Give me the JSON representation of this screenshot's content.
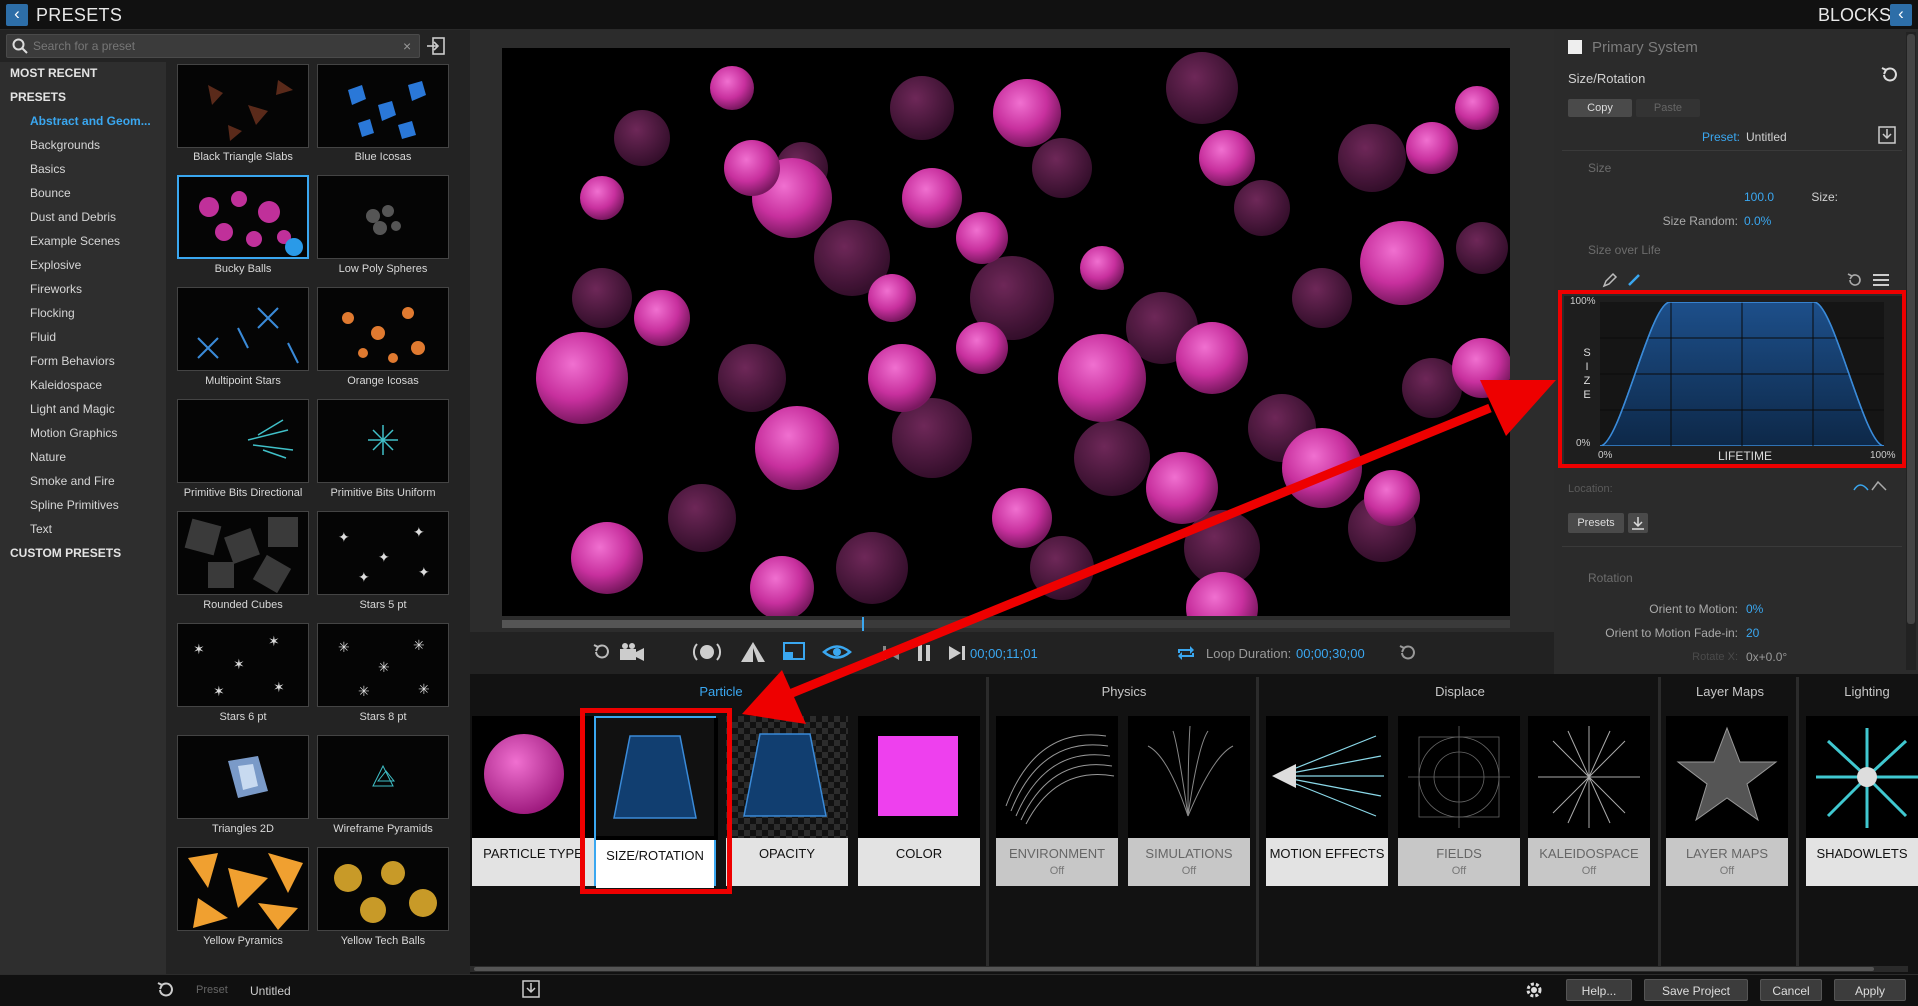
{
  "header": {
    "left_title": "PRESETS",
    "right_title": "BLOCKS",
    "back_icon": "chevron-left-icon"
  },
  "search": {
    "placeholder": "Search for a preset",
    "clear": "×"
  },
  "categories": {
    "most_recent": "MOST RECENT",
    "presets": "PRESETS",
    "items": [
      "Abstract and Geom...",
      "Backgrounds",
      "Basics",
      "Bounce",
      "Dust and Debris",
      "Example Scenes",
      "Explosive",
      "Fireworks",
      "Flocking",
      "Fluid",
      "Form Behaviors",
      "Kaleidospace",
      "Light and Magic",
      "Motion Graphics",
      "Nature",
      "Smoke and Fire",
      "Spline Primitives",
      "Text"
    ],
    "custom": "CUSTOM PRESETS"
  },
  "presets": [
    "Black Triangle Slabs",
    "Blue Icosas",
    "Bucky Balls",
    "Low Poly Spheres",
    "Multipoint Stars",
    "Orange Icosas",
    "Primitive Bits Directional",
    "Primitive Bits Uniform",
    "Rounded Cubes",
    "Stars 5 pt",
    "Stars 6 pt",
    "Stars 8 pt",
    "Triangles 2D",
    "Wireframe Pyramids",
    "Yellow Pyramics",
    "Yellow Tech Balls"
  ],
  "transport": {
    "timecode": "00;00;11;01",
    "loop_label": "Loop Duration:",
    "loop_value": "00;00;30;00"
  },
  "right": {
    "system": "Primary System",
    "section": "Size/Rotation",
    "copy": "Copy",
    "paste": "Paste",
    "preset_label": "Preset:",
    "preset_value": "Untitled",
    "size_head": "Size",
    "size_label": "Size:",
    "size_value": "100.0",
    "size_random_label": "Size Random:",
    "size_random_value": "0.0%",
    "size_over_life": "Size over Life",
    "graph": {
      "y_top": "100%",
      "y_bottom": "0%",
      "x_left": "0%",
      "x_right": "100%",
      "x_title": "LIFETIME",
      "y_title": [
        "S",
        "I",
        "Z",
        "E"
      ]
    },
    "location": "Location:",
    "presets_btn": "Presets",
    "rotation_head": "Rotation",
    "orient_label": "Orient to Motion:",
    "orient_value": "0%",
    "fade_label": "Orient to Motion Fade-in:",
    "fade_value": "20",
    "rotate_label": "Rotate X:",
    "rotate_value": "0x+0.0°"
  },
  "groups": {
    "particle": "Particle",
    "physics": "Physics",
    "displace": "Displace",
    "layer_maps": "Layer Maps",
    "lighting": "Lighting"
  },
  "blocks": [
    {
      "label": "PARTICLE TYPE",
      "sub": ""
    },
    {
      "label": "SIZE/ROTATION",
      "sub": ""
    },
    {
      "label": "OPACITY",
      "sub": ""
    },
    {
      "label": "COLOR",
      "sub": ""
    },
    {
      "label": "ENVIRONMENT",
      "sub": "Off"
    },
    {
      "label": "SIMULATIONS",
      "sub": "Off"
    },
    {
      "label": "MOTION EFFECTS",
      "sub": ""
    },
    {
      "label": "FIELDS",
      "sub": "Off"
    },
    {
      "label": "KALEIDOSPACE",
      "sub": "Off"
    },
    {
      "label": "LAYER MAPS",
      "sub": "Off"
    },
    {
      "label": "SHADOWLETS",
      "sub": ""
    }
  ],
  "status": {
    "preset_label": "Preset",
    "preset_value": "Untitled",
    "help": "Help...",
    "save": "Save Project",
    "cancel": "Cancel",
    "apply": "Apply"
  },
  "colors": {
    "accent": "#3aa7f0",
    "highlight": "#ee0000",
    "particle": "#e040b0"
  }
}
